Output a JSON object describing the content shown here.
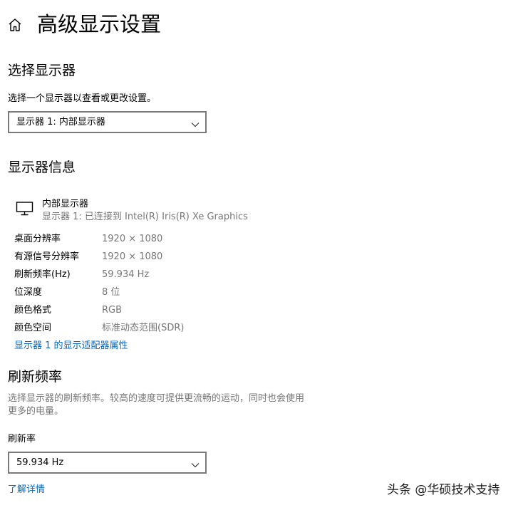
{
  "header": {
    "title": "高级显示设置"
  },
  "select_display": {
    "heading": "选择显示器",
    "description": "选择一个显示器以查看或更改设置。",
    "selected": "显示器 1: 内部显示器"
  },
  "display_info": {
    "heading": "显示器信息",
    "monitor_name": "内部显示器",
    "monitor_detail": "显示器 1: 已连接到 Intel(R) Iris(R) Xe Graphics",
    "rows": [
      {
        "label": "桌面分辨率",
        "value": "1920 × 1080"
      },
      {
        "label": "有源信号分辨率",
        "value": "1920 × 1080"
      },
      {
        "label": "刷新频率(Hz)",
        "value": "59.934 Hz"
      },
      {
        "label": "位深度",
        "value": "8 位"
      },
      {
        "label": "颜色格式",
        "value": "RGB"
      },
      {
        "label": "颜色空间",
        "value": "标准动态范围(SDR)"
      }
    ],
    "adapter_link": "显示器 1 的显示适配器属性"
  },
  "refresh_rate": {
    "heading": "刷新频率",
    "description_line1": "选择显示器的刷新频率。较高的速度可提供更流畅的运动，同时也会使用",
    "description_line2": "更多的电量。",
    "field_label": "刷新率",
    "selected": "59.934 Hz",
    "learn_more": "了解详情"
  },
  "watermark": "头条 @华硕技术支持",
  "colors": {
    "accent": "#0067c0",
    "secondary_text": "#767676",
    "dropdown_border": "#7a7a7a"
  },
  "icons": {
    "home": "home-icon",
    "monitor": "monitor-icon",
    "dropdown": "chevron-down-icon"
  }
}
